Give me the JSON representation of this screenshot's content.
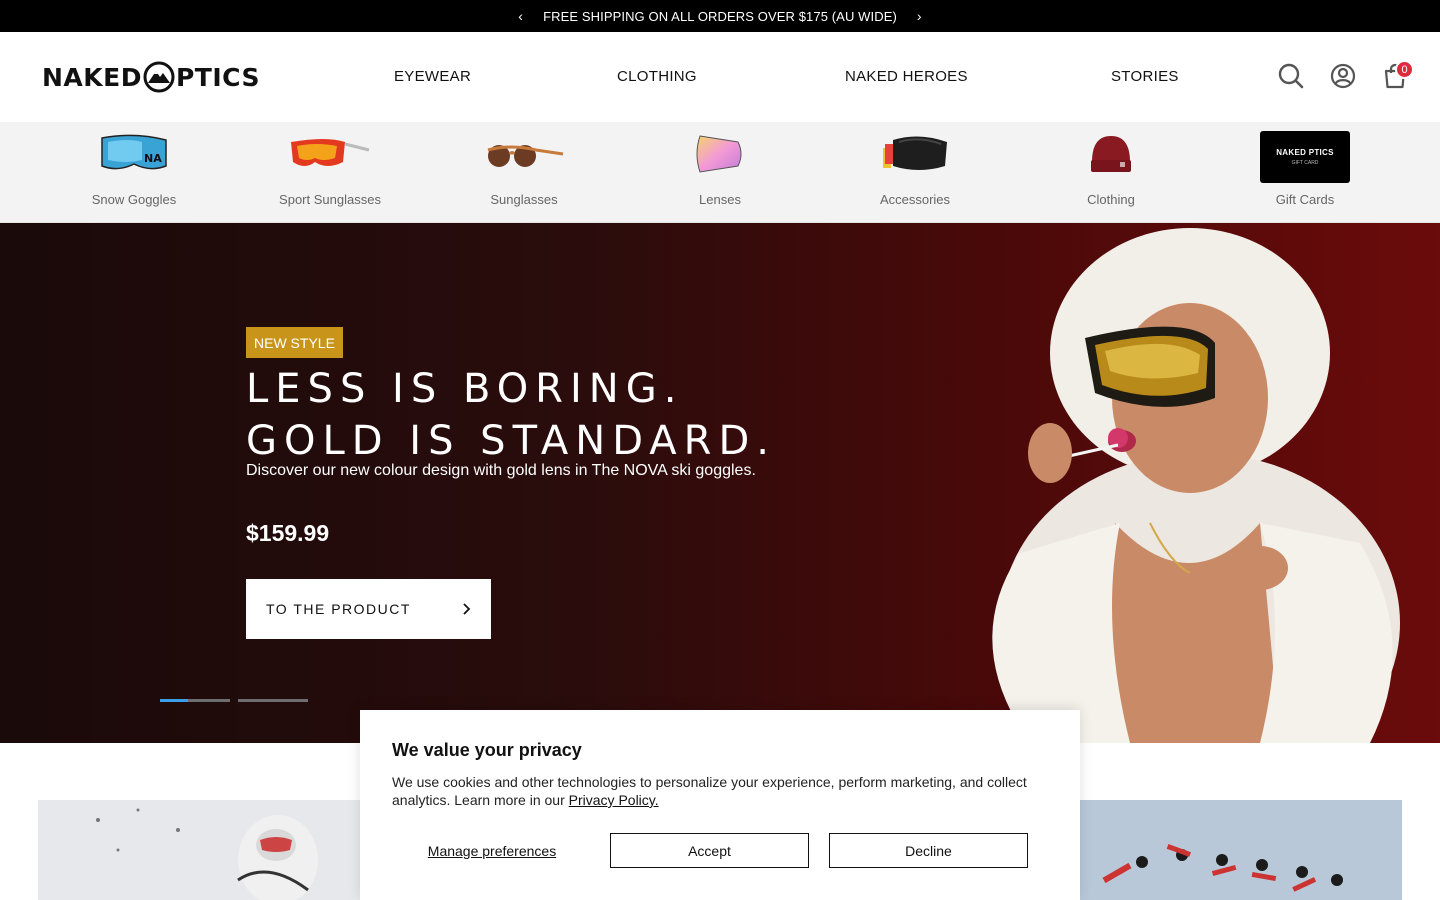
{
  "announcement": {
    "text": "FREE SHIPPING ON ALL ORDERS OVER $175 (AU WIDE)",
    "prev": "‹",
    "next": "›"
  },
  "header": {
    "logo_left": "NAKED",
    "logo_right": "PTICS",
    "nav": [
      {
        "label": "EYEWEAR"
      },
      {
        "label": "CLOTHING"
      },
      {
        "label": "NAKED HEROES"
      },
      {
        "label": "STORIES"
      }
    ],
    "icons": [
      "search-icon",
      "account-icon",
      "cart-icon"
    ],
    "cart_count": "0"
  },
  "categories": [
    {
      "label": "Snow Goggles",
      "icon": "snow-goggles-thumb"
    },
    {
      "label": "Sport Sunglasses",
      "icon": "sport-sunglasses-thumb"
    },
    {
      "label": "Sunglasses",
      "icon": "sunglasses-thumb"
    },
    {
      "label": "Lenses",
      "icon": "lens-thumb"
    },
    {
      "label": "Accessories",
      "icon": "accessory-thumb"
    },
    {
      "label": "Clothing",
      "icon": "beanie-thumb"
    },
    {
      "label": "Gift Cards",
      "icon": "gift-card-thumb",
      "card_text": "NAKED PTICS",
      "card_sub": "GIFT CARD"
    }
  ],
  "hero": {
    "badge": "NEW STYLE",
    "title_line1": "LESS IS BORING.",
    "title_line2": "GOLD IS STANDARD.",
    "subtitle": "Discover our new colour design with gold lens in The NOVA ski goggles.",
    "price": "$159.99",
    "cta": "TO THE PRODUCT",
    "slides": [
      {
        "active": true,
        "progress": 0.4
      },
      {
        "active": false,
        "progress": 0
      }
    ]
  },
  "cookie": {
    "title": "We value your privacy",
    "body": "We use cookies and other technologies to personalize your experience, perform marketing, and collect analytics. Learn more in our",
    "link": "Privacy Policy.",
    "manage": "Manage preferences",
    "accept": "Accept",
    "decline": "Decline"
  },
  "colors": {
    "badge": "#c8951a",
    "cart_badge": "#e0293b",
    "slide_active": "#3b9fe8"
  }
}
